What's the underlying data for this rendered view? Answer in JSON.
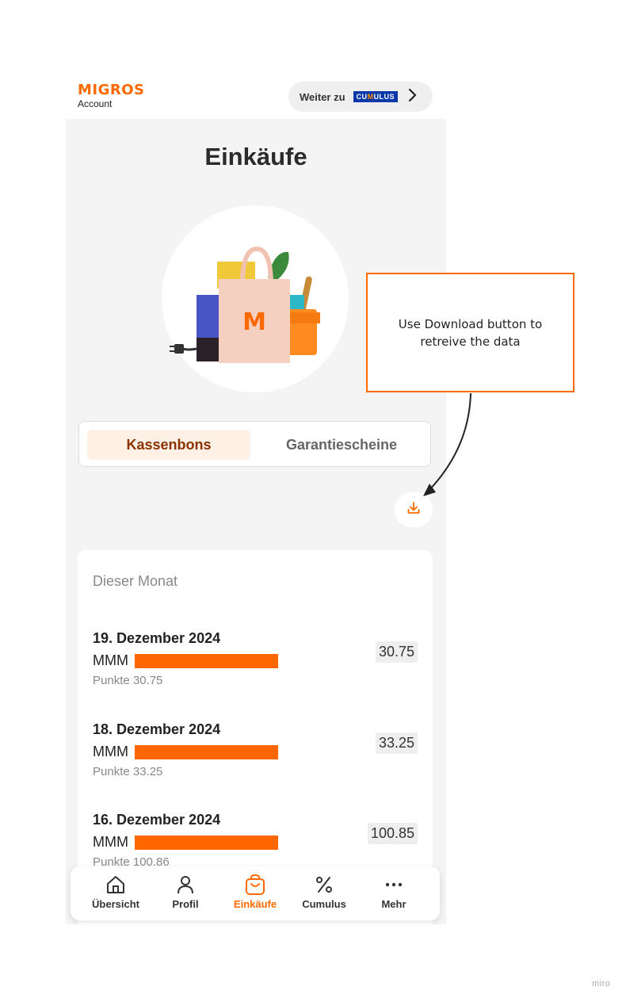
{
  "header": {
    "logo_title": "MIGROS",
    "logo_subtitle": "Account",
    "weiter_label": "Weiter zu",
    "cumulus_badge_pre": "CU",
    "cumulus_badge_m": "M",
    "cumulus_badge_post": "ULUS"
  },
  "page": {
    "title": "Einkäufe",
    "hero_bag_letter": "M"
  },
  "segments": [
    {
      "label": "Kassenbons",
      "active": true
    },
    {
      "label": "Garantiescheine",
      "active": false
    }
  ],
  "download_icon": "download-icon",
  "purchases": {
    "month_label": "Dieser Monat",
    "receipts": [
      {
        "date": "19. Dezember 2024",
        "store": "MMM",
        "points": "Punkte 30.75",
        "amount": "30.75"
      },
      {
        "date": "18. Dezember 2024",
        "store": "MMM",
        "points": "Punkte 33.25",
        "amount": "33.25"
      },
      {
        "date": "16. Dezember 2024",
        "store": "MMM",
        "points": "Punkte 100.86",
        "amount": "100.85"
      }
    ]
  },
  "bottom_nav": [
    {
      "label": "Übersicht",
      "icon": "home-icon",
      "active": false
    },
    {
      "label": "Profil",
      "icon": "user-icon",
      "active": false
    },
    {
      "label": "Einkäufe",
      "icon": "shopping-bag-icon",
      "active": true
    },
    {
      "label": "Cumulus",
      "icon": "percent-icon",
      "active": false
    },
    {
      "label": "Mehr",
      "icon": "more-icon",
      "active": false
    }
  ],
  "annotation": {
    "callout_text": "Use Download button to retreive the data"
  },
  "watermark": "miro",
  "colors": {
    "brand_orange": "#ff6a00",
    "active_tab_bg": "#fff0e6",
    "active_tab_text": "#8a3200",
    "cumulus_blue": "#0b3aa8",
    "redaction_bar": "#ff6600"
  }
}
